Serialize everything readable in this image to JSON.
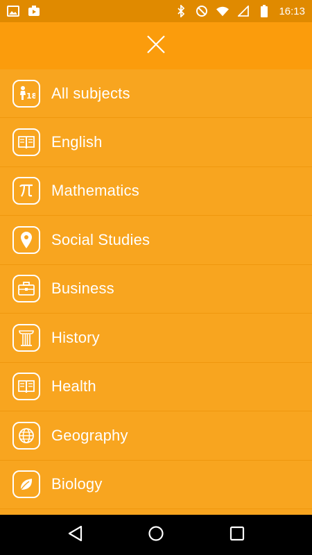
{
  "status_bar": {
    "time": "16:13",
    "left_icons": [
      "image-icon",
      "youtube-icon"
    ],
    "right_icons": [
      "bluetooth-icon",
      "do-not-disturb-icon",
      "wifi-icon",
      "signal-icon",
      "battery-icon"
    ]
  },
  "header": {
    "close_icon": "close-icon"
  },
  "menu": {
    "items": [
      {
        "label": "All subjects",
        "icon": "all-subjects-icon"
      },
      {
        "label": "English",
        "icon": "book-icon"
      },
      {
        "label": "Mathematics",
        "icon": "pi-icon"
      },
      {
        "label": "Social Studies",
        "icon": "location-pin-icon"
      },
      {
        "label": "Business",
        "icon": "briefcase-icon"
      },
      {
        "label": "History",
        "icon": "column-icon"
      },
      {
        "label": "Health",
        "icon": "book-icon"
      },
      {
        "label": "Geography",
        "icon": "globe-icon"
      },
      {
        "label": "Biology",
        "icon": "leaf-icon"
      }
    ]
  },
  "colors": {
    "status_bar": "#e08a00",
    "header": "#fb9c0c",
    "menu_background": "#f8a51f",
    "nav_bar": "#000000",
    "text": "#ffffff"
  },
  "nav_bar": {
    "icons": [
      "back-icon",
      "home-icon",
      "recents-icon"
    ]
  }
}
